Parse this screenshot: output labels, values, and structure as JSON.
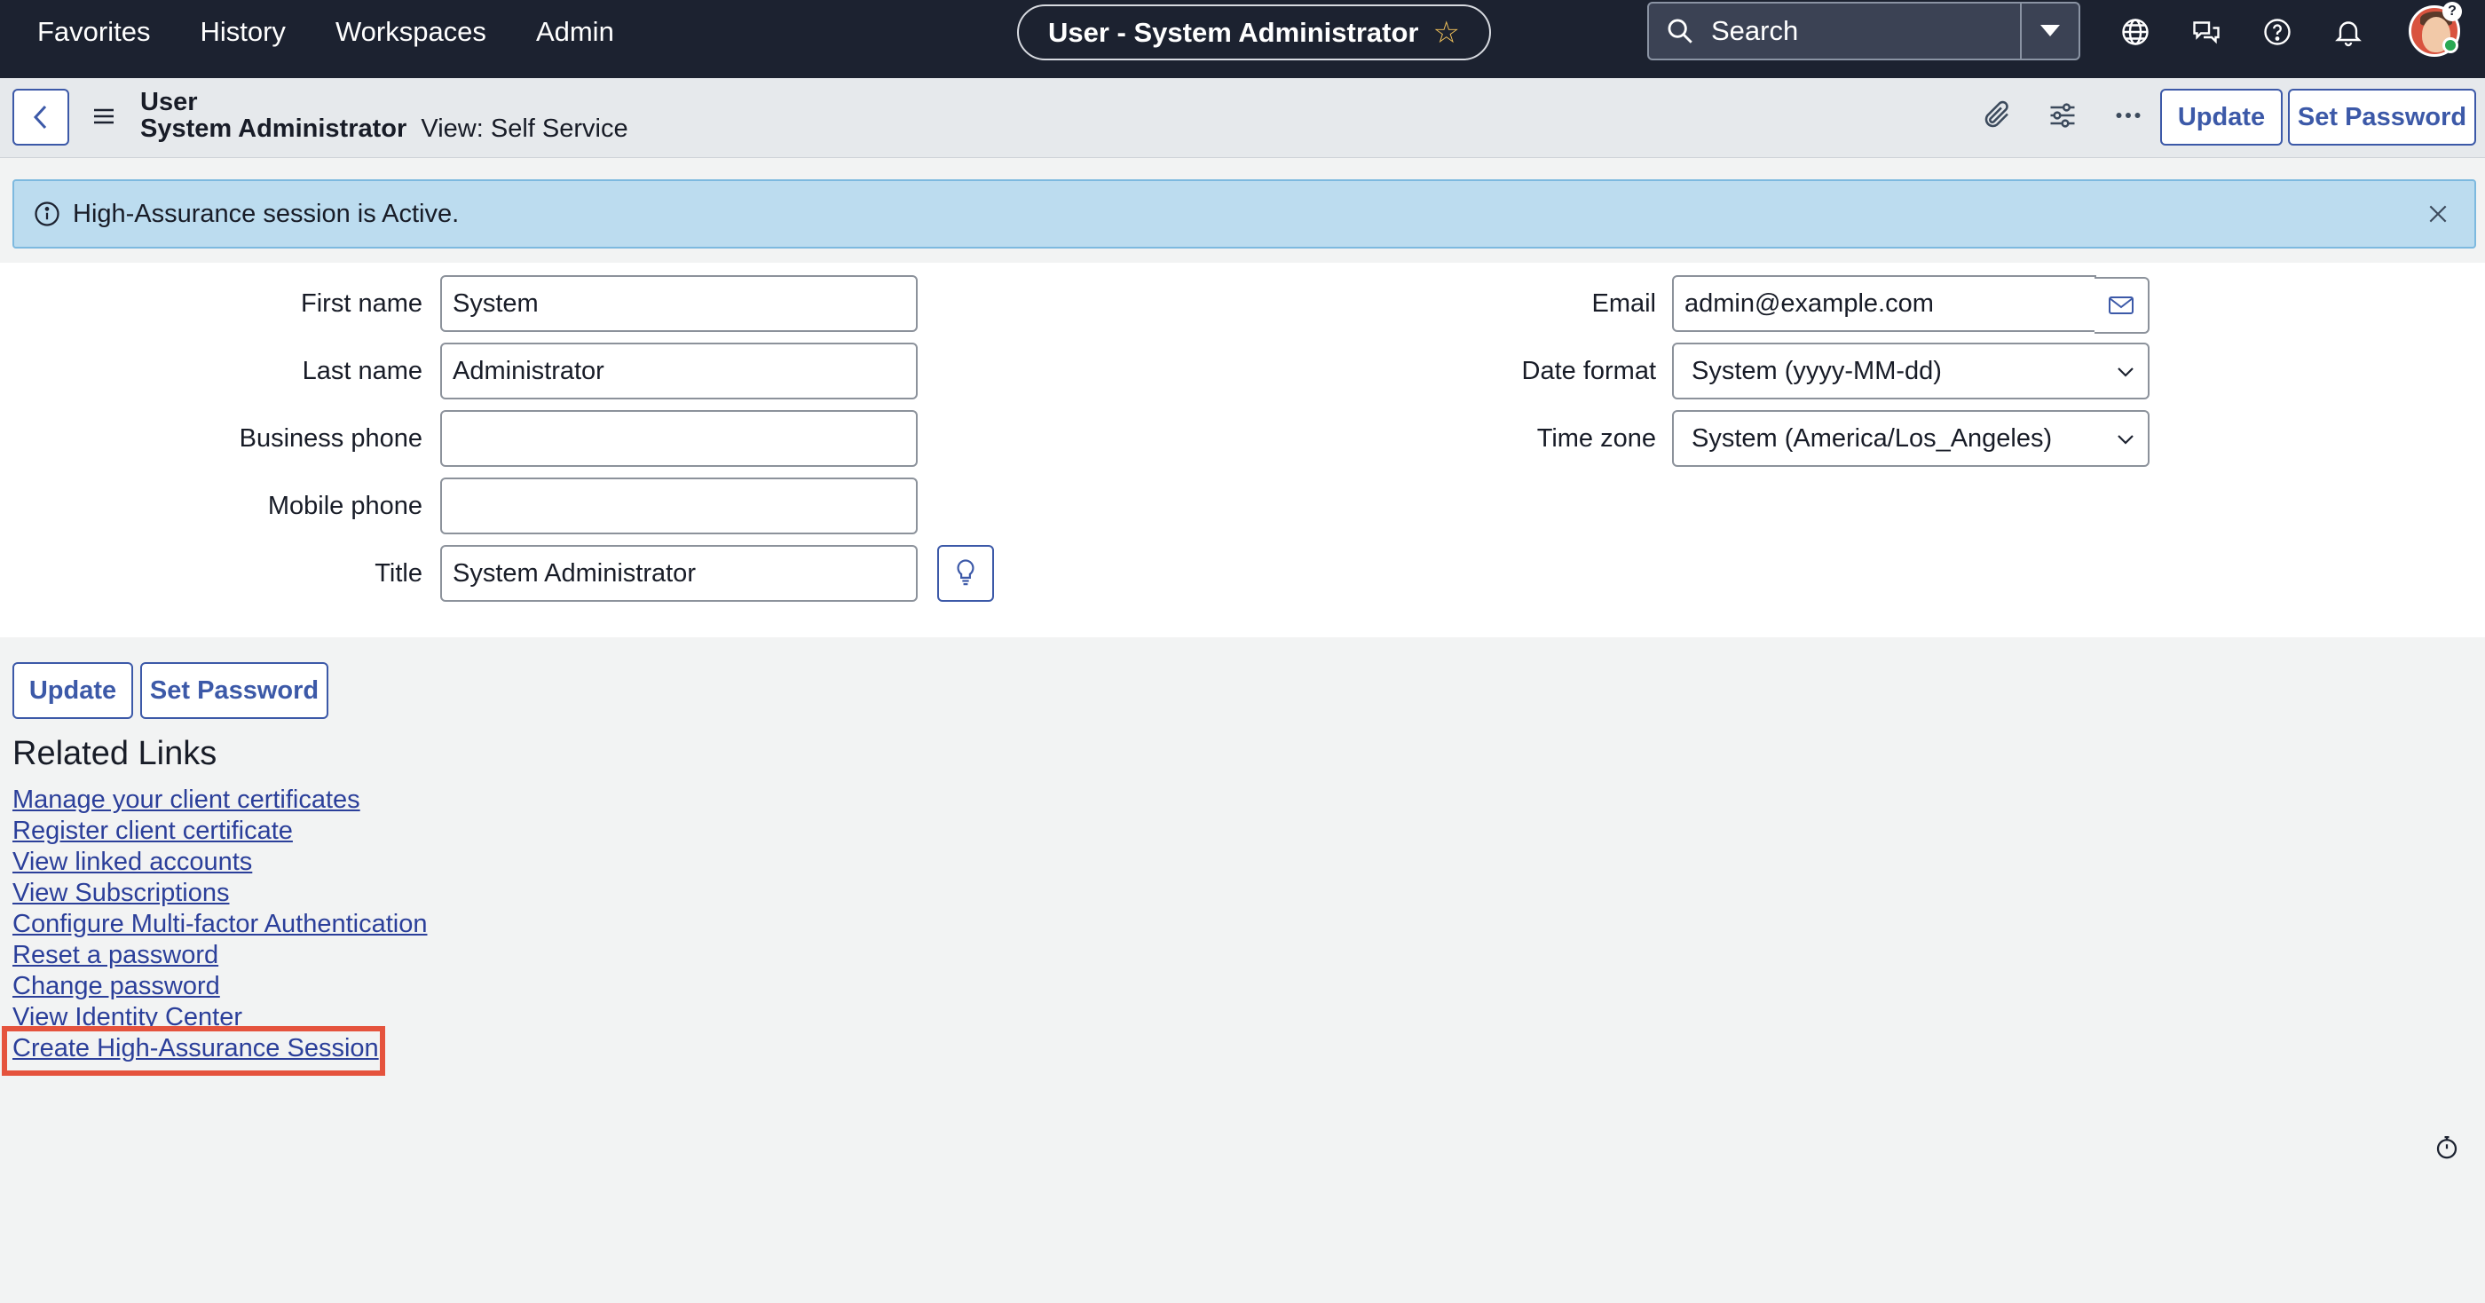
{
  "topnav": {
    "menu": [
      "Favorites",
      "History",
      "Workspaces",
      "Admin"
    ],
    "context_title": "User - System Administrator",
    "search_label": "Search"
  },
  "form_header": {
    "table_label": "User",
    "record_name": "System Administrator",
    "view_label": "View: Self Service",
    "update_label": "Update",
    "set_password_label": "Set Password"
  },
  "banner": {
    "message": "High-Assurance session is Active."
  },
  "fields_left": [
    {
      "label": "First name",
      "value": "System"
    },
    {
      "label": "Last name",
      "value": "Administrator"
    },
    {
      "label": "Business phone",
      "value": ""
    },
    {
      "label": "Mobile phone",
      "value": ""
    },
    {
      "label": "Title",
      "value": "System Administrator"
    }
  ],
  "fields_right": [
    {
      "label": "Email",
      "value": "admin@example.com"
    },
    {
      "label": "Date format",
      "value": "System (yyyy-MM-dd)"
    },
    {
      "label": "Time zone",
      "value": "System (America/Los_Angeles)"
    }
  ],
  "bottom_buttons": {
    "update_label": "Update",
    "set_password_label": "Set Password"
  },
  "related_links": {
    "title": "Related Links",
    "items": [
      "Manage your client certificates",
      "Register client certificate",
      "View linked accounts",
      "View Subscriptions",
      "Configure Multi-factor Authentication",
      "Reset a password",
      "Change password",
      "View Identity Center",
      "Create High-Assurance Session"
    ]
  },
  "colors": {
    "nav_bg": "#1c2230",
    "accent": "#3c59a8",
    "banner_bg": "#bcdcef",
    "highlight": "#e5533d",
    "link": "#2b3f9a"
  }
}
